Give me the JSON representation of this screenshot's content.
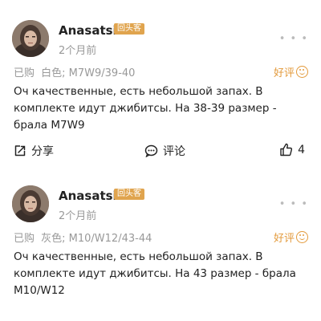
{
  "reviews": [
    {
      "username": "Anasatsia",
      "badge": "回头客",
      "time": "2个月前",
      "bought_prefix": "已购",
      "variant": "白色; M7W9/39-40",
      "good_label": "好评",
      "text": "Оч качественные, есть небольшой запах.   В комплекте идут джибитсы.  На 38-39 размер - брала M7W9",
      "share_label": "分享",
      "comment_label": "评论",
      "likes": "4"
    },
    {
      "username": "Anasatsia",
      "badge": "回头客",
      "time": "2个月前",
      "bought_prefix": "已购",
      "variant": "灰色; M10/W12/43-44",
      "good_label": "好评",
      "text": "Оч качественные, есть небольшой запах.   В комплекте идут джибитсы.  На 43 размер - брала M10/W12"
    }
  ],
  "icons": {
    "more": "more-dots-icon",
    "good": "smile-icon",
    "share": "share-icon",
    "comment": "comment-icon",
    "like": "thumbs-up-icon"
  },
  "colors": {
    "badge": "#e0a44e",
    "good": "#e39a3b",
    "muted": "#999999"
  }
}
